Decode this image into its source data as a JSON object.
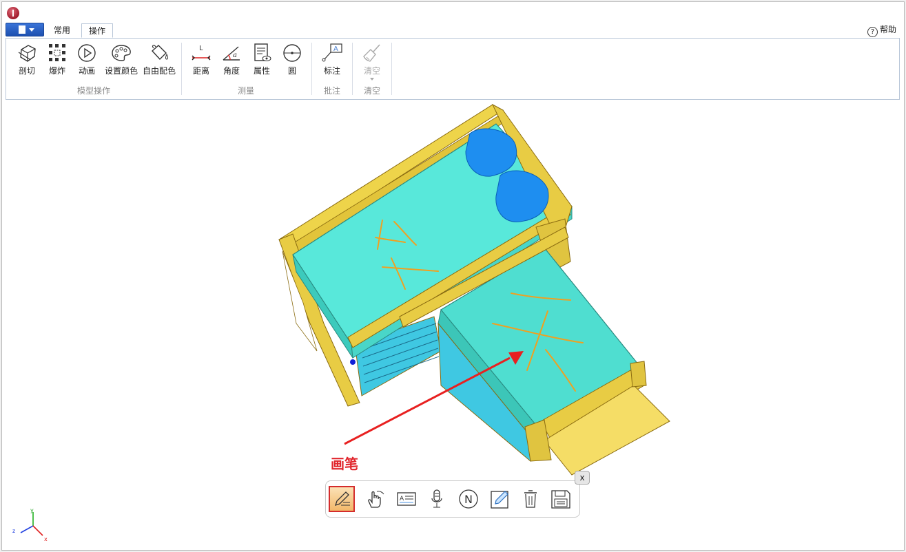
{
  "tabs": [
    {
      "label": "常用"
    },
    {
      "label": "操作",
      "active": true
    }
  ],
  "help_label": "帮助",
  "groups": [
    {
      "label": "模型操作",
      "buttons": [
        {
          "label": "剖切",
          "icon": "section-cube-icon"
        },
        {
          "label": "爆炸",
          "icon": "explode-icon"
        },
        {
          "label": "动画",
          "icon": "play-icon"
        },
        {
          "label": "设置颜色",
          "icon": "palette-icon"
        },
        {
          "label": "自由配色",
          "icon": "paint-bucket-icon"
        }
      ]
    },
    {
      "label": "测量",
      "buttons": [
        {
          "label": "距离",
          "icon": "distance-icon",
          "glyph": "L"
        },
        {
          "label": "角度",
          "icon": "angle-icon",
          "glyph": "a"
        },
        {
          "label": "属性",
          "icon": "property-icon"
        },
        {
          "label": "圆",
          "icon": "circle-icon"
        }
      ]
    },
    {
      "label": "批注",
      "buttons": [
        {
          "label": "标注",
          "icon": "annotate-icon",
          "glyph": "A"
        }
      ]
    },
    {
      "label": "清空",
      "buttons": [
        {
          "label": "清空",
          "icon": "broom-icon",
          "disabled": true
        }
      ]
    }
  ],
  "annotation_callout": "画笔",
  "toolbar": {
    "tools": [
      {
        "name": "pen",
        "icon": "pen-icon",
        "selected": true
      },
      {
        "name": "hand",
        "icon": "hand-icon"
      },
      {
        "name": "text",
        "icon": "text-box-icon"
      },
      {
        "name": "voice",
        "icon": "microphone-icon"
      },
      {
        "name": "note",
        "icon": "note-n-icon",
        "glyph": "N"
      },
      {
        "name": "edit",
        "icon": "pencil-square-icon"
      },
      {
        "name": "delete",
        "icon": "trash-icon"
      },
      {
        "name": "save",
        "icon": "save-icon"
      }
    ],
    "close_label": "x"
  },
  "axes": {
    "x": "x",
    "y": "y",
    "z": "z"
  },
  "colors": {
    "model_frame": "#e8cf4a",
    "model_mattress": "#56e6d6",
    "pillow": "#1e8ef0",
    "stroke": "#f0a020",
    "arrow": "#e82020"
  }
}
